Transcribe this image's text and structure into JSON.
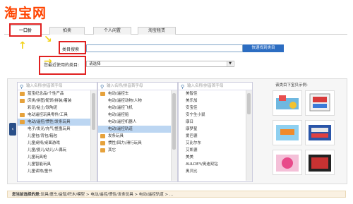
{
  "logo": "淘宝网",
  "tabs": [
    {
      "label": "一口价"
    },
    {
      "label": "拍卖"
    },
    {
      "label": "个人闲置"
    },
    {
      "label": "淘宝租赁"
    }
  ],
  "search": {
    "label": "类目搜索",
    "button": "快速找到类目"
  },
  "recent": {
    "label": "您最近使用的类目:",
    "value": "请选择"
  },
  "columns": [
    {
      "search_placeholder": "输入名称/拼音首字母",
      "items": [
        {
          "label": "蓝宝纪念品/个性产品",
          "arrow": ">"
        },
        {
          "label": "床类/拼图/配饰/拼装/着装",
          "arrow": ">"
        },
        {
          "label": "彩泥/粘土/软陶泥",
          "arrow": ">"
        },
        {
          "label": "电动遥控玩具零件/工具",
          "arrow": ">"
        },
        {
          "label": "电动/遥控/惯性/发条玩具",
          "arrow": ">",
          "selected": true
        },
        {
          "label": "电子/发光/充气/整蛊玩具",
          "arrow": ">"
        },
        {
          "label": "儿童包/背包/箱包",
          "arrow": ">"
        },
        {
          "label": "儿童桌椅/桌面游戏",
          "arrow": ">"
        },
        {
          "label": "儿童/婴儿/幼儿/人偶玩",
          "arrow": ">"
        },
        {
          "label": "儿童玩具枪",
          "arrow": ">"
        },
        {
          "label": "儿童智能玩具",
          "arrow": ">"
        },
        {
          "label": "儿童读物/童书",
          "arrow": ">"
        }
      ]
    },
    {
      "search_placeholder": "输入名称/拼音首字母",
      "items": [
        {
          "label": "电动/遥控车",
          "arrow": ">"
        },
        {
          "label": "电动/遥控动物/人物",
          "arrow": ""
        },
        {
          "label": "电动/遥控飞机",
          "arrow": ""
        },
        {
          "label": "电动/遥控船",
          "arrow": ""
        },
        {
          "label": "电动/遥控机器人",
          "arrow": ""
        },
        {
          "label": "电动/遥控轨道",
          "arrow": ">",
          "selected": true
        },
        {
          "label": "发条玩具",
          "arrow": ""
        },
        {
          "label": "惯性/回力/滑行玩具",
          "arrow": ""
        },
        {
          "label": "其它",
          "arrow": ""
        }
      ]
    },
    {
      "search_placeholder": "输入名称/拼音首字母",
      "items": [
        {
          "label": "美智佳"
        },
        {
          "label": "美乐加"
        },
        {
          "label": "安宝佳"
        },
        {
          "label": "安宁生小鼠"
        },
        {
          "label": "康日"
        },
        {
          "label": "康梦星"
        },
        {
          "label": "爱巴德"
        },
        {
          "label": "艾比尔东"
        },
        {
          "label": "艾凯德"
        },
        {
          "label": "美美"
        },
        {
          "label": "AULDEY/奥迪双钻"
        },
        {
          "label": "奥贝比"
        }
      ]
    }
  ],
  "samples_title": "该类目下宝贝示例:",
  "breadcrumb": {
    "label": "您当前选择的是:",
    "path": "玩具/童车/益智/积木/模型 > 电动/遥控/惯性/发条玩具 > 电动/遥控轨道 > ..."
  },
  "colors": {
    "brand": "#ff4400",
    "highlight": "#e02020",
    "button": "#2c6dc2"
  }
}
